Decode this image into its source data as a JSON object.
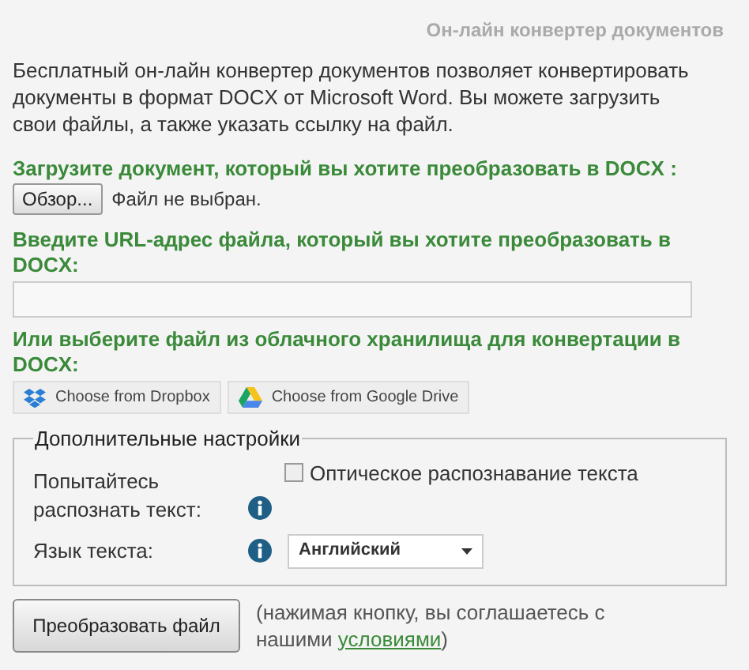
{
  "header": {
    "title": "Он-лайн конвертер документов"
  },
  "intro": "Бесплатный он-лайн конвертер документов позволяет конвертировать документы в формат DOCX от Microsoft Word. Вы можете загрузить свои файлы, а также указать ссылку на файл.",
  "upload": {
    "heading": "Загрузите документ, который вы хотите преобразовать в DOCX :",
    "browse_button": "Обзор...",
    "file_status": "Файл не выбран."
  },
  "url": {
    "heading": "Введите URL-адрес файла, который вы хотите преобразовать в DOCX:"
  },
  "cloud": {
    "heading": "Или выберите файл из облачного хранилища для конвертации в DOCX:",
    "buttons": [
      {
        "kind": "dropbox",
        "label": "Choose from Dropbox"
      },
      {
        "kind": "drive",
        "label": "Choose from Google Drive"
      }
    ]
  },
  "settings": {
    "legend": "Дополнительные настройки",
    "ocr": {
      "label": "Попытайтесь распознать текст:",
      "option": "Оптическое распознавание текста",
      "checked": false
    },
    "language": {
      "label": "Язык текста:",
      "value": "Английский"
    }
  },
  "submit": {
    "button": "Преобразовать файл",
    "note_before": "(нажимая кнопку, вы соглашаетесь с нашими ",
    "note_link": "условиями",
    "note_after": ")"
  }
}
